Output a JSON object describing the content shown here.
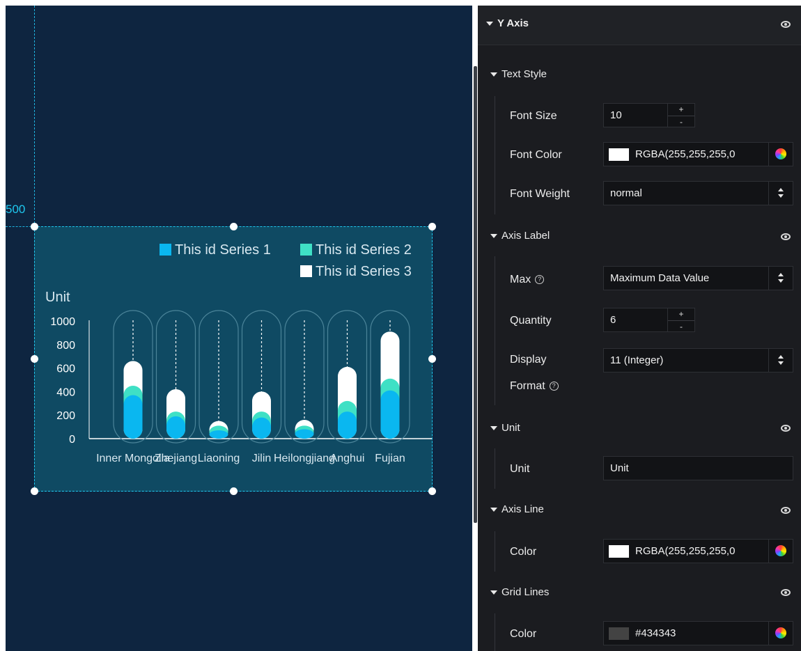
{
  "canvas": {
    "ruler_label": "500",
    "widget": {
      "chart_data": {
        "type": "bar",
        "ylabel": "Unit",
        "ylim": [
          0,
          1000
        ],
        "yticks": [
          "1000",
          "800",
          "600",
          "400",
          "200",
          "0"
        ],
        "categories": [
          "Inner Mongolia",
          "Zhejiang",
          "Liaoning",
          "Jilin",
          "Heilongjiang",
          "Anghui",
          "Fujian"
        ],
        "series": [
          {
            "name": "This id Series 1",
            "color": "#0ab7f0",
            "values": [
              370,
              190,
              20,
              180,
              80,
              230,
              410
            ]
          },
          {
            "name": "This id Series 2",
            "color": "#3fe0c5",
            "values": [
              80,
              40,
              90,
              50,
              30,
              90,
              100
            ]
          },
          {
            "name": "This id Series 3",
            "color": "#ffffff",
            "values": [
              210,
              190,
              40,
              170,
              50,
              290,
              400
            ]
          }
        ],
        "track_color": "#ffffff",
        "stacked": true,
        "legend_position": "top-right",
        "grid": false
      }
    }
  },
  "panel": {
    "header": {
      "title": "Y Axis"
    },
    "text_style": {
      "title": "Text Style",
      "font_size": {
        "label": "Font Size",
        "value": "10",
        "plus": "+",
        "minus": "-"
      },
      "font_color": {
        "label": "Font Color",
        "value": "RGBA(255,255,255,0",
        "swatch": "#ffffff"
      },
      "font_weight": {
        "label": "Font Weight",
        "value": "normal"
      }
    },
    "axis_label": {
      "title": "Axis Label",
      "max": {
        "label": "Max",
        "value": "Maximum Data Value"
      },
      "quantity": {
        "label": "Quantity",
        "value": "6",
        "plus": "+",
        "minus": "-"
      },
      "display_format": {
        "label_1": "Display",
        "label_2": "Format",
        "value": "11 (Integer)"
      }
    },
    "unit": {
      "title": "Unit",
      "label": "Unit",
      "value": "Unit"
    },
    "axis_line": {
      "title": "Axis Line",
      "label": "Color",
      "value": "RGBA(255,255,255,0",
      "swatch": "#ffffff"
    },
    "grid_lines": {
      "title": "Grid Lines",
      "label": "Color",
      "value": "#434343",
      "swatch": "#434343"
    }
  }
}
